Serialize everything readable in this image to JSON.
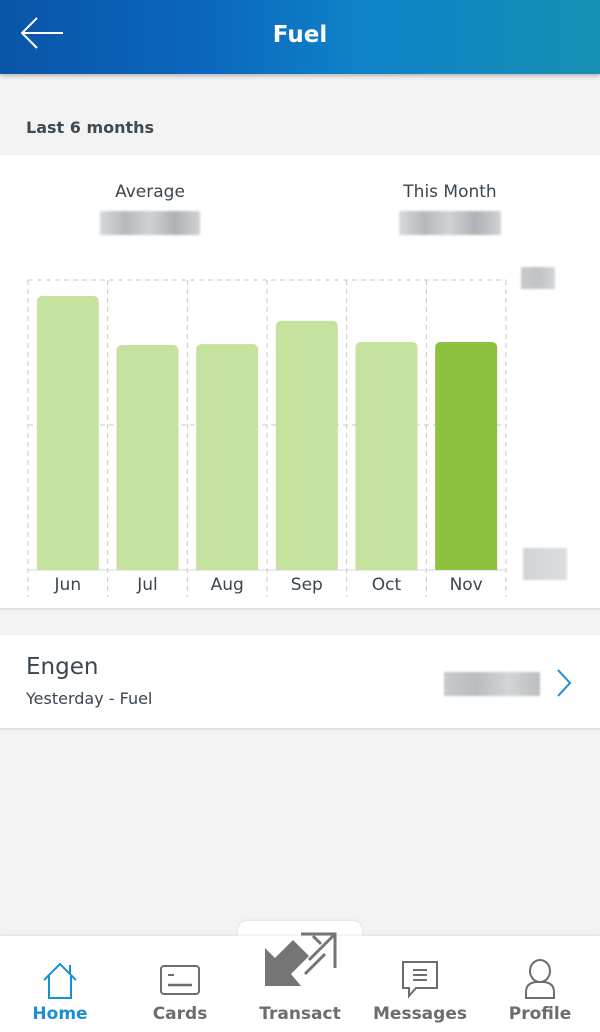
{
  "header": {
    "title": "Fuel",
    "back_icon": "arrow-left-icon"
  },
  "section_label": "Last 6 months",
  "summary": {
    "average_label": "Average",
    "average_value": "",
    "this_month_label": "This Month",
    "this_month_value": ""
  },
  "colors": {
    "bar": "#c6e29f",
    "bar_current": "#8cc23f",
    "grid": "#c8c8c8",
    "accent": "#1c8fd0",
    "header_start": "#0a54a8",
    "header_end": "#168fb3"
  },
  "chart_data": {
    "type": "bar",
    "title": "",
    "xlabel": "",
    "ylabel": "",
    "categories": [
      "Jun",
      "Jul",
      "Aug",
      "Sep",
      "Oct",
      "Nov"
    ],
    "values": [
      0.945,
      0.776,
      0.779,
      0.859,
      0.786,
      0.786
    ],
    "value_units": "fraction of top gridline (axis labels redacted)",
    "highlighted_category": "Nov",
    "ylim": [
      0,
      1
    ],
    "gridlines": [
      0.5,
      1
    ],
    "grid": true,
    "y_tick_labels": [
      "",
      ""
    ],
    "legend": "none"
  },
  "transaction": {
    "merchant": "Engen",
    "subtitle": "Yesterday - Fuel",
    "amount": ""
  },
  "tabbar": {
    "items": [
      {
        "label": "Home",
        "icon": "home-icon",
        "active": true
      },
      {
        "label": "Cards",
        "icon": "card-icon",
        "active": false
      },
      {
        "label": "Transact",
        "icon": "transfer-arrows-icon",
        "active": false
      },
      {
        "label": "Messages",
        "icon": "message-icon",
        "active": false
      },
      {
        "label": "Profile",
        "icon": "person-icon",
        "active": false
      }
    ]
  }
}
